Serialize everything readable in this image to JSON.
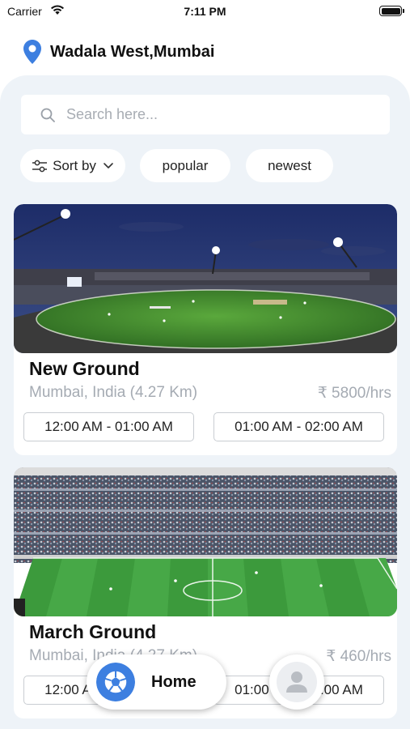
{
  "status_bar": {
    "carrier": "Carrier",
    "time": "7:11 PM",
    "icons": [
      "wifi-icon",
      "battery-icon"
    ]
  },
  "location": {
    "text": "Wadala West,Mumbai",
    "icon": "map-pin-icon"
  },
  "search": {
    "placeholder": "Search here...",
    "value": "",
    "icon": "search-icon"
  },
  "filters": {
    "sort_label": "Sort by",
    "popular_label": "popular",
    "newest_label": "newest"
  },
  "grounds": [
    {
      "name": "New Ground",
      "address": "Mumbai, India (4.27 Km)",
      "price": "₹ 5800/hrs",
      "slots": [
        "12:00 AM - 01:00 AM",
        "01:00 AM - 02:00 AM"
      ],
      "image": "cricket-stadium-night-photo"
    },
    {
      "name": "March Ground",
      "address": "Mumbai, India (4.27 Km)",
      "price": "₹ 460/hrs",
      "slots": [
        "12:00 AM - 01:00 AM",
        "01:00 AM - 02:00 AM"
      ],
      "image": "football-stadium-photo"
    }
  ],
  "bottom_nav": {
    "home_label": "Home",
    "home_icon": "soccer-ball-icon",
    "profile_icon": "user-avatar-icon"
  },
  "colors": {
    "accent": "#3d7fe0",
    "panel_bg": "#eef3f8",
    "muted_text": "#a5abb3"
  }
}
